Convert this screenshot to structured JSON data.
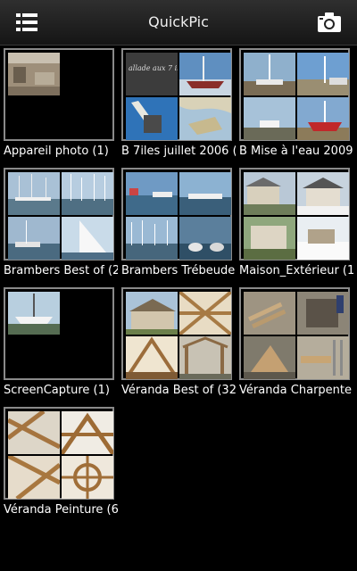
{
  "header": {
    "title": "QuickPic",
    "menu_icon": "list-menu-icon",
    "camera_icon": "camera-icon"
  },
  "albums": [
    {
      "label": "Appareil photo (1)"
    },
    {
      "label": "B 7iles juillet 2006 (",
      "thumb_text": "allade aux 7 il"
    },
    {
      "label": "B Mise à l'eau 2009"
    },
    {
      "label": "Brambers Best of (2"
    },
    {
      "label": "Brambers Trébeude"
    },
    {
      "label": "Maison_Extérieur (1"
    },
    {
      "label": "ScreenCapture (1)"
    },
    {
      "label": "Véranda Best of (32"
    },
    {
      "label": "Véranda Charpente"
    },
    {
      "label": "Véranda Peinture (6"
    }
  ]
}
